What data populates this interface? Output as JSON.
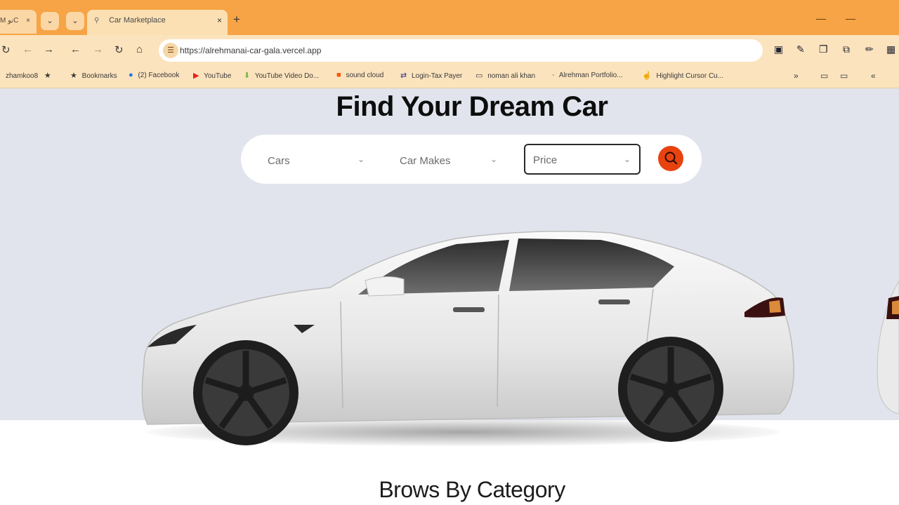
{
  "browser": {
    "prev_tab_label": "M نو⁠C",
    "active_tab_title": "Car Marketplace",
    "new_tab_symbol": "+",
    "url": "https://alrehmanai-car-gala.vercel.app",
    "bookmarks": [
      {
        "label": "zhamkoo8",
        "icon": "star-icon"
      },
      {
        "label": "Bookmarks",
        "icon": "star-icon"
      },
      {
        "label": "(2) Facebook",
        "icon": "facebook-icon"
      },
      {
        "label": "YouTube",
        "icon": "youtube-icon"
      },
      {
        "label": "YouTube Video Do...",
        "icon": "download-icon"
      },
      {
        "label": "sound cloud",
        "icon": "soundcloud-icon"
      },
      {
        "label": "Login-Tax Payer",
        "icon": "login-icon"
      },
      {
        "label": "noman ali khan",
        "icon": "folder-icon"
      },
      {
        "label": "Alrehman Portfolio...",
        "icon": "portfolio-icon"
      },
      {
        "label": "Highlight Cursor Cu...",
        "icon": "cursor-icon"
      }
    ]
  },
  "page": {
    "hero_title": "Find Your Dream Car",
    "search": {
      "cars_label": "Cars",
      "makes_label": "Car Makes",
      "price_label": "Price"
    },
    "section_title": "Brows By Category"
  },
  "colors": {
    "tabstrip": "#f6a445",
    "toolbar": "#fbe3bd",
    "hero_bg": "#e1e4ec",
    "search_button": "#e8430f"
  }
}
